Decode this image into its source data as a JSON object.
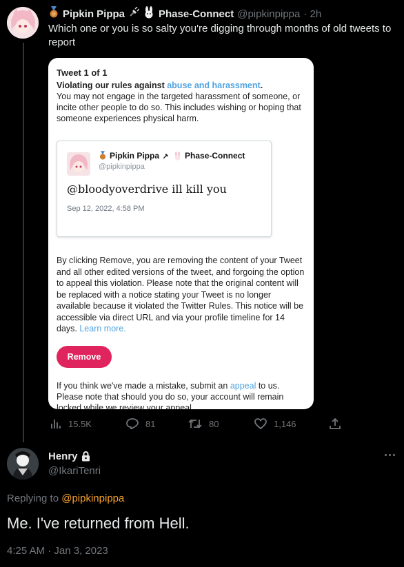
{
  "parent_tweet": {
    "display_name": "Pipkin Pippa",
    "badge_icons": [
      "medal-icon",
      "plug-icon",
      "rabbit-icon"
    ],
    "affiliation": "Phase-Connect",
    "handle": "@pipkinpippa",
    "time_ago": "· 2h",
    "text": "Which one or you is so salty you're digging through months of old tweets to report",
    "stats": {
      "views": "15.5K",
      "replies": "81",
      "retweets": "80",
      "likes": "1,146"
    }
  },
  "media_card": {
    "heading": "Tweet 1 of 1",
    "violation_prefix": "Violating our rules against ",
    "violation_link": "abuse and harassment",
    "violation_suffix": ".",
    "rule_text": "You may not engage in the targeted harassment of someone, or incite other people to do so. This includes wishing or hoping that someone experiences physical harm.",
    "embedded_tweet": {
      "display_name": "Pipkin Pippa",
      "affiliation": "Phase-Connect",
      "handle": "@pipkinpippa",
      "text": "@bloodyoverdrive ill kill you",
      "timestamp": "Sep 12, 2022, 4:58 PM"
    },
    "removal_text": "By clicking Remove, you are removing the content of your Tweet and all other edited versions of the tweet, and forgoing the option to appeal this violation. Please note that the original content will be replaced with a notice stating your Tweet is no longer available because it violated the Twitter Rules. This notice will be accessible via direct URL and via your profile timeline for 14 days. ",
    "learn_more": "Learn more.",
    "remove_label": "Remove",
    "appeal_prefix": "If you think we've made a mistake, submit an ",
    "appeal_link": "appeal",
    "appeal_suffix": " to us.",
    "appeal_followup": "Please note that should you do so, your account will remain locked while we review your appeal."
  },
  "reply_tweet": {
    "display_name": "Henry",
    "lock_icon": "lock-icon",
    "handle": "@IkariTenri",
    "replying_prefix": "Replying to ",
    "replying_handle": "@pipkinpippa",
    "text": "Me. I've returned from Hell.",
    "timestamp": "4:25 AM · Jan 3, 2023"
  },
  "colors": {
    "background": "#000000",
    "link_orange": "#f7a02c",
    "remove_red": "#e0245e",
    "card_link_blue": "#4fa3e0"
  }
}
